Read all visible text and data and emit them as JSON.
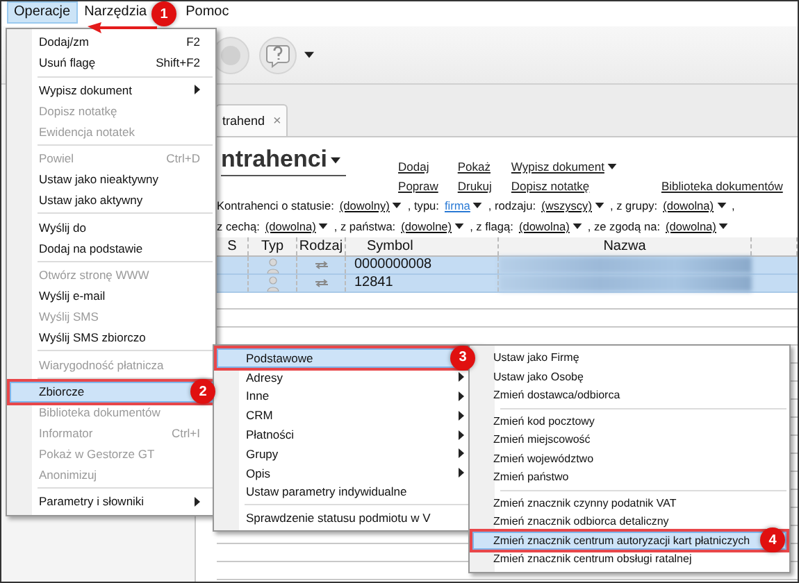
{
  "menubar": [
    {
      "label": "Operacje",
      "selected": true,
      "badge": "1"
    },
    {
      "label": "Narzędzia",
      "selected": false
    },
    {
      "label": "Pomoc",
      "selected": false
    }
  ],
  "tab": {
    "label": "trahend",
    "close": "×"
  },
  "view": {
    "title": "ntrahenci",
    "link_columns": [
      [
        {
          "label": "Dodaj",
          "dropdown": false
        },
        {
          "label": "Popraw",
          "dropdown": false
        }
      ],
      [
        {
          "label": "Pokaż",
          "dropdown": false
        },
        {
          "label": "Drukuj",
          "dropdown": false
        }
      ],
      [
        {
          "label": "Wypisz dokument",
          "dropdown": true
        },
        {
          "label": "Dopisz notatkę",
          "dropdown": false
        }
      ],
      [
        {
          "label": "Biblioteka dokumentów",
          "dropdown": false
        }
      ]
    ]
  },
  "filters": [
    [
      {
        "kind": "text",
        "text": "Kontrahenci o statusie:"
      },
      {
        "kind": "dropdown",
        "text": "(dowolny)",
        "active": false
      },
      {
        "kind": "text",
        "text": ", typu:"
      },
      {
        "kind": "dropdown",
        "text": "firma",
        "active": true
      },
      {
        "kind": "text",
        "text": ", rodzaju:"
      },
      {
        "kind": "dropdown",
        "text": "(wszyscy)",
        "active": false
      },
      {
        "kind": "text",
        "text": ", z grupy:"
      },
      {
        "kind": "dropdown",
        "text": "(dowolna)",
        "active": false
      },
      {
        "kind": "text",
        "text": ","
      }
    ],
    [
      {
        "kind": "text",
        "text": "z cechą:"
      },
      {
        "kind": "dropdown",
        "text": "(dowolna)",
        "active": false
      },
      {
        "kind": "text",
        "text": ", z państwa:"
      },
      {
        "kind": "dropdown",
        "text": "(dowolne)",
        "active": false
      },
      {
        "kind": "text",
        "text": ", z flagą:"
      },
      {
        "kind": "dropdown",
        "text": "(dowolna)",
        "active": false
      },
      {
        "kind": "text",
        "text": ", ze zgodą na:"
      },
      {
        "kind": "dropdown",
        "text": "(dowolna)",
        "active": false
      }
    ]
  ],
  "table": {
    "columns": [
      "S",
      "Typ",
      "Rodzaj",
      "Symbol",
      "Nazwa"
    ],
    "rows": [
      {
        "symbol": "0000000008",
        "selected": true
      },
      {
        "symbol": "12841",
        "selected": true
      }
    ]
  },
  "menus": [
    {
      "items": [
        {
          "kind": "item",
          "label": "Dodaj/zm",
          "shortcut": "F2",
          "disabled": false,
          "selected": false
        },
        {
          "kind": "item",
          "label": "Usuń flagę",
          "shortcut": "Shift+F2",
          "disabled": false,
          "selected": false
        },
        {
          "kind": "separator"
        },
        {
          "kind": "item",
          "label": "Wypisz dokument",
          "submenu": true,
          "disabled": false,
          "selected": false
        },
        {
          "kind": "item",
          "label": "Dopisz notatkę",
          "disabled": true,
          "selected": false
        },
        {
          "kind": "item",
          "label": "Ewidencja notatek",
          "disabled": true,
          "selected": false
        },
        {
          "kind": "separator"
        },
        {
          "kind": "item",
          "label": "Powiel",
          "shortcut": "Ctrl+D",
          "disabled": true,
          "selected": false
        },
        {
          "kind": "item",
          "label": "Ustaw jako nieaktywny",
          "disabled": false,
          "selected": false
        },
        {
          "kind": "item",
          "label": "Ustaw jako aktywny",
          "disabled": false,
          "selected": false
        },
        {
          "kind": "separator"
        },
        {
          "kind": "item",
          "label": "Wyślij do",
          "disabled": false,
          "selected": false
        },
        {
          "kind": "item",
          "label": "Dodaj na podstawie",
          "disabled": false,
          "selected": false
        },
        {
          "kind": "separator"
        },
        {
          "kind": "item",
          "label": "Otwórz stronę WWW",
          "disabled": true,
          "selected": false
        },
        {
          "kind": "item",
          "label": "Wyślij e-mail",
          "disabled": false,
          "selected": false
        },
        {
          "kind": "item",
          "label": "Wyślij SMS",
          "disabled": true,
          "selected": false
        },
        {
          "kind": "item",
          "label": "Wyślij SMS zbiorczo",
          "disabled": false,
          "selected": false
        },
        {
          "kind": "separator"
        },
        {
          "kind": "item",
          "label": "Wiarygodność płatnicza",
          "disabled": true,
          "selected": false
        },
        {
          "kind": "separator"
        },
        {
          "kind": "item",
          "label": "Zbiorcze",
          "disabled": false,
          "selected": true,
          "badge": "2"
        },
        {
          "kind": "item",
          "label": "Biblioteka dokumentów",
          "disabled": true,
          "selected": false
        },
        {
          "kind": "item",
          "label": "Informator",
          "shortcut": "Ctrl+I",
          "disabled": true,
          "selected": false
        },
        {
          "kind": "item",
          "label": "Pokaż w Gestorze GT",
          "disabled": true,
          "selected": false
        },
        {
          "kind": "item",
          "label": "Anonimizuj",
          "disabled": true,
          "selected": false
        },
        {
          "kind": "separator"
        },
        {
          "kind": "item",
          "label": "Parametry i słowniki",
          "submenu": true,
          "disabled": false,
          "selected": false
        }
      ]
    },
    {
      "items": [
        {
          "kind": "item",
          "label": "Podstawowe",
          "disabled": false,
          "selected": true,
          "badge": "3"
        },
        {
          "kind": "item",
          "label": "Adresy",
          "submenu": true,
          "disabled": false,
          "selected": false
        },
        {
          "kind": "item",
          "label": "Inne",
          "submenu": true,
          "disabled": false,
          "selected": false
        },
        {
          "kind": "item",
          "label": "CRM",
          "submenu": true,
          "disabled": false,
          "selected": false
        },
        {
          "kind": "item",
          "label": "Płatności",
          "submenu": true,
          "disabled": false,
          "selected": false
        },
        {
          "kind": "item",
          "label": "Grupy",
          "submenu": true,
          "disabled": false,
          "selected": false
        },
        {
          "kind": "item",
          "label": "Opis",
          "submenu": true,
          "disabled": false,
          "selected": false
        },
        {
          "kind": "item",
          "label": "Ustaw parametry indywidualne",
          "disabled": false,
          "selected": false
        },
        {
          "kind": "separator"
        },
        {
          "kind": "item",
          "label": "Sprawdzenie statusu podmiotu w V",
          "disabled": false,
          "selected": false
        }
      ]
    },
    {
      "items": [
        {
          "kind": "item",
          "label": "Ustaw jako Firmę",
          "disabled": false,
          "selected": false
        },
        {
          "kind": "item",
          "label": "Ustaw jako Osobę",
          "disabled": false,
          "selected": false
        },
        {
          "kind": "item",
          "label": "Zmień dostawca/odbiorca",
          "disabled": false,
          "selected": false
        },
        {
          "kind": "separator"
        },
        {
          "kind": "item",
          "label": "Zmień kod pocztowy",
          "disabled": false,
          "selected": false
        },
        {
          "kind": "item",
          "label": "Zmień miejscowość",
          "disabled": false,
          "selected": false
        },
        {
          "kind": "item",
          "label": "Zmień województwo",
          "disabled": false,
          "selected": false
        },
        {
          "kind": "item",
          "label": "Zmień państwo",
          "disabled": false,
          "selected": false
        },
        {
          "kind": "separator"
        },
        {
          "kind": "item",
          "label": "Zmień znacznik czynny podatnik VAT",
          "disabled": false,
          "selected": false
        },
        {
          "kind": "item",
          "label": "Zmień znacznik odbiorca detaliczny",
          "disabled": false,
          "selected": false
        },
        {
          "kind": "item",
          "label": "Zmień znacznik centrum autoryzacji kart płatniczych",
          "disabled": false,
          "selected": true,
          "badge": "4"
        },
        {
          "kind": "item",
          "label": "Zmień znacznik centrum obsługi ratalnej",
          "disabled": false,
          "selected": false
        }
      ]
    }
  ]
}
